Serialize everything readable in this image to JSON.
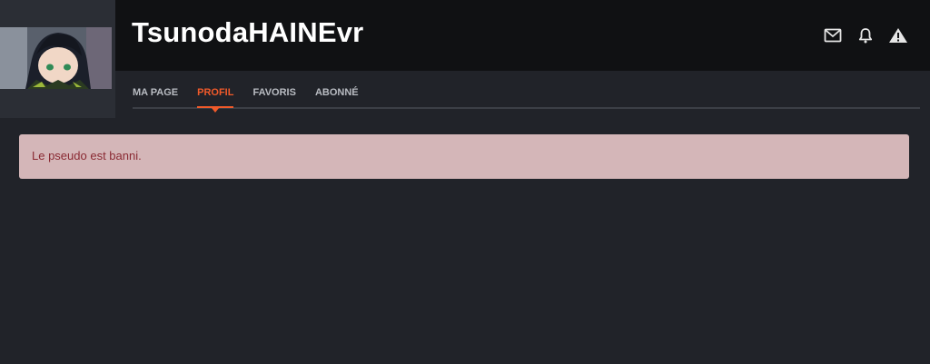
{
  "header": {
    "username": "TsunodaHAINEvr",
    "icons": [
      {
        "name": "mail-icon"
      },
      {
        "name": "bell-icon"
      },
      {
        "name": "warning-icon"
      }
    ]
  },
  "nav": {
    "tabs": [
      {
        "label": "MA PAGE",
        "active": false
      },
      {
        "label": "PROFIL",
        "active": true
      },
      {
        "label": "FAVORIS",
        "active": false
      },
      {
        "label": "ABONNÉ",
        "active": false
      }
    ],
    "accent_color": "#f05a2a"
  },
  "alert": {
    "message": "Le pseudo est banni.",
    "background": "#d4b6b8",
    "text_color": "#8a2a33"
  }
}
